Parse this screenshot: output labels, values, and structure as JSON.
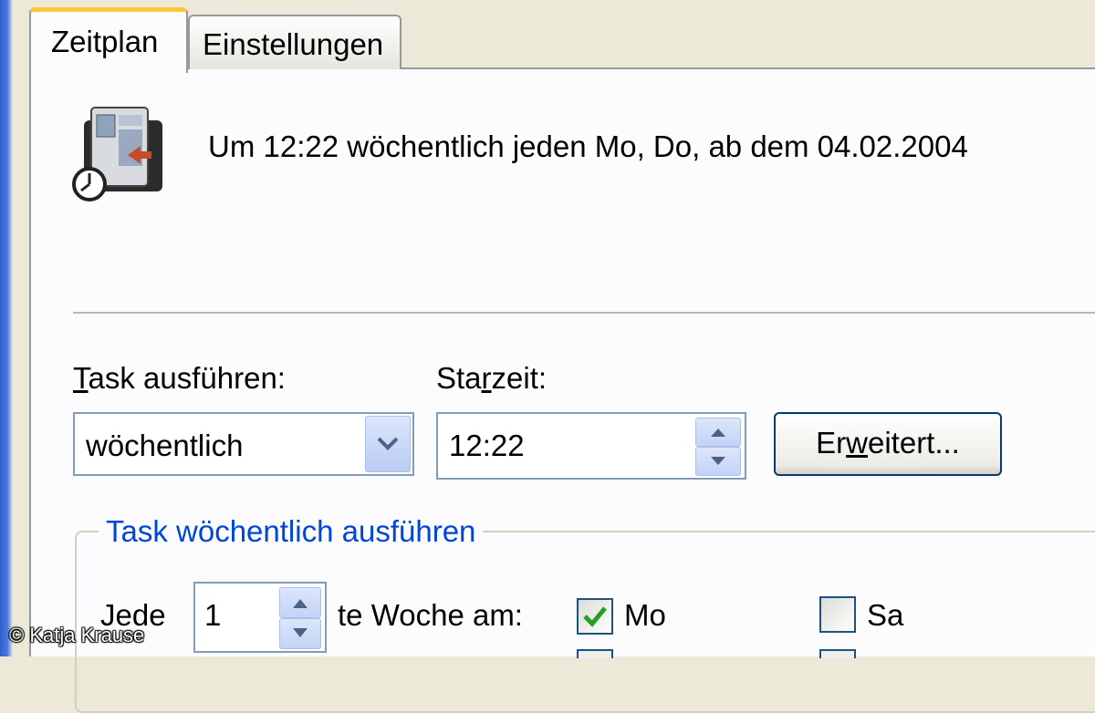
{
  "tabs": {
    "schedule": "Zeitplan",
    "settings": "Einstellungen"
  },
  "summary": "Um 12:22 wöchentlich jeden Mo, Do, ab dem 04.02.2004",
  "run_task": {
    "label_rest": "ask ausführen:",
    "value": "wöchentlich"
  },
  "start_time": {
    "label_pre": "Sta",
    "label_rest": "zeit:",
    "value": "12:22"
  },
  "advanced_button": {
    "pre": "Er",
    "post": "eitert..."
  },
  "weekly_group": {
    "title": "Task wöchentlich ausführen",
    "every_label": "Jede",
    "interval": "1",
    "week_label": "te Woche am:",
    "days": {
      "mo": {
        "label": "Mo",
        "checked": true
      },
      "sa": {
        "label": "Sa",
        "checked": false
      }
    }
  },
  "copyright": "© Katja Krause",
  "colors": {
    "tab_highlight": "#ffc83c",
    "group_title": "#0046d5",
    "check": "#21a121"
  }
}
